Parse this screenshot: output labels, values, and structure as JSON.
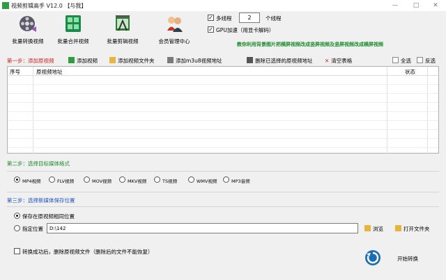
{
  "window": {
    "title": "视频剪辑高手 V12.0  【与我】",
    "minimize": "—",
    "maximize": "□",
    "close": "✕"
  },
  "toolbar": [
    {
      "name": "batch-convert",
      "label": "批量转换视频",
      "icon": "film-reel-icon"
    },
    {
      "name": "batch-merge",
      "label": "批量合并视频",
      "icon": "merge-grid-icon"
    },
    {
      "name": "batch-edit",
      "label": "批量剪辑视频",
      "icon": "clapper-icon"
    },
    {
      "name": "member-center",
      "label": "会员管理中心",
      "icon": "members-icon"
    }
  ],
  "options": {
    "multithread_label": "多线程",
    "multithread_checked": true,
    "thread_count": "2",
    "thread_unit": "个线程",
    "gpu_label": "GPU加速（用显卡解码）",
    "gpu_checked": true
  },
  "notice": "教你利用背景图片把横屏视频改成竖屏视频及竖屏视频改成横屏视频",
  "step1": {
    "title": "第一步：添加原视频",
    "add_video": "添加视频",
    "add_folder": "添加视频文件夹",
    "add_m3u8": "添加m3u8视频地址",
    "delete_selected": "删除已选择的原视频地址",
    "clear_table": "清空表格",
    "select_all": "全选",
    "invert": "反选"
  },
  "table": {
    "columns": [
      "序号",
      "原视频地址",
      "状态"
    ],
    "rows": []
  },
  "step2": {
    "title": "第二步：选择目标媒体格式",
    "formats": [
      "MP4视频",
      "FLV视频",
      "MOV视频",
      "MKV视频",
      "TS视频",
      "WMV视频",
      "MP3音频"
    ],
    "selected": 0
  },
  "step3": {
    "title": "第三步：选择新媒体保存位置",
    "same_location": "保存在原视频相同位置",
    "custom_location": "指定位置",
    "path": "D:\\142",
    "browse": "浏览",
    "open_folder": "打开文件夹",
    "selected": 0
  },
  "footer": {
    "delete_after_label": "转换成功后，删除原视频文件（删除后的文件不能恢复）",
    "delete_after_checked": false,
    "start_label": "开始转换"
  },
  "colors": {
    "step_title": "#d02020",
    "step_title_alt": "#1a8a2a",
    "notice": "#1a8a2a"
  }
}
